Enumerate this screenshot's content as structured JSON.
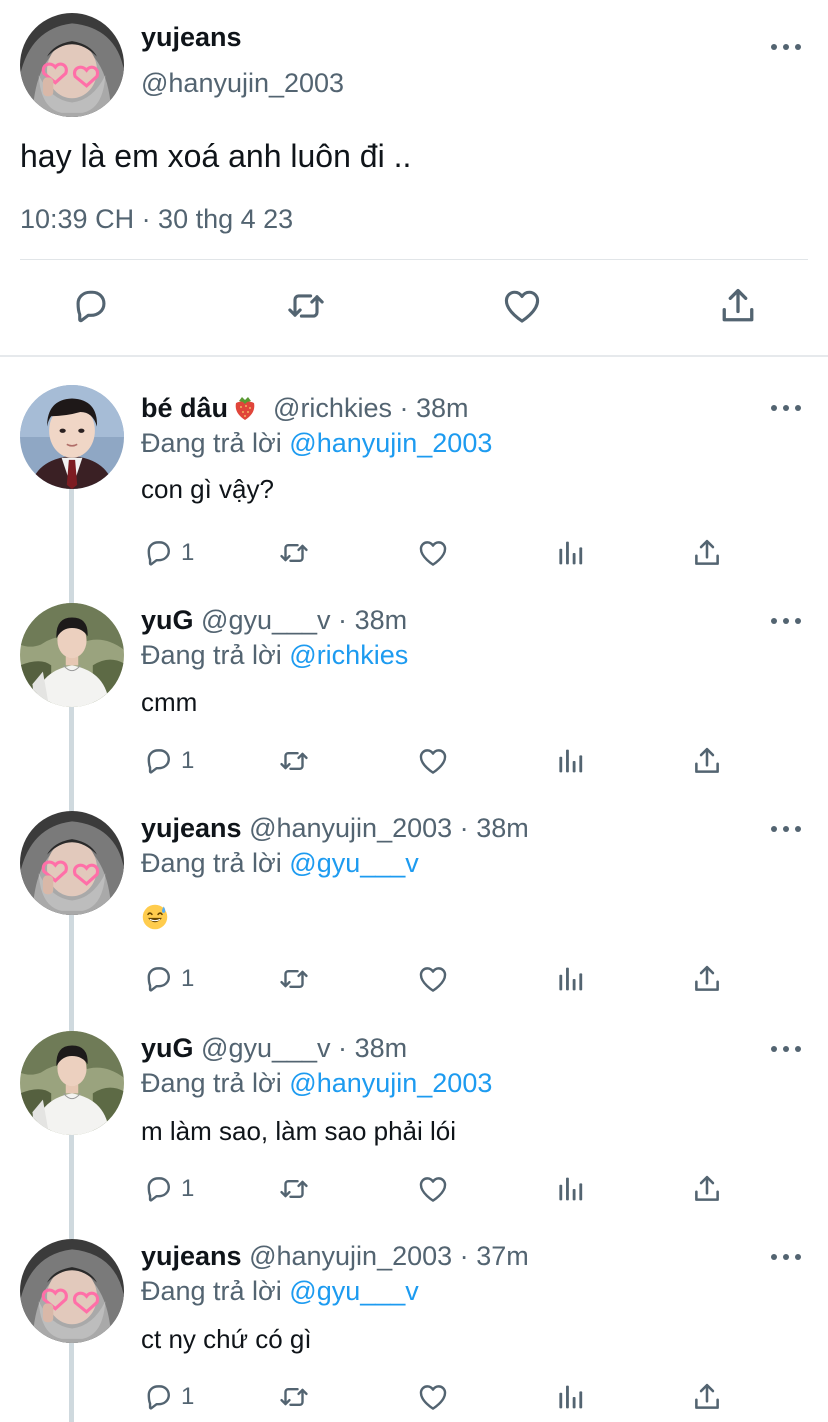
{
  "main_tweet": {
    "name": "yujeans",
    "handle": "@hanyujin_2003",
    "text": "hay là em xoá anh luôn đi ..",
    "timestamp": "10:39 CH · 30 thg 4 23",
    "actions": [
      "reply-icon",
      "retweet-icon",
      "like-icon",
      "share-icon"
    ]
  },
  "replies": [
    {
      "name": "bé dâu",
      "name_emoji": "strawberry",
      "handle": "@richkies",
      "separator": "·",
      "time": "38m",
      "replying_prefix": "Đang trả lời",
      "replying_to": "@hanyujin_2003",
      "text": "con gì vậy?",
      "reply_count": "1",
      "avatar": "boy-uniform"
    },
    {
      "name": "yuG",
      "handle": "@gyu___v",
      "separator": "·",
      "time": "38m",
      "replying_prefix": "Đang trả lời",
      "replying_to": "@richkies",
      "text": "cmm",
      "reply_count": "1",
      "avatar": "boy-white-shirt"
    },
    {
      "name": "yujeans",
      "handle": "@hanyujin_2003",
      "separator": "·",
      "time": "38m",
      "replying_prefix": "Đang trả lời",
      "replying_to": "@gyu___v",
      "text": "",
      "text_emoji": "grinning-sweat",
      "reply_count": "1",
      "avatar": "hoodie-hearts"
    },
    {
      "name": "yuG",
      "handle": "@gyu___v",
      "separator": "·",
      "time": "38m",
      "replying_prefix": "Đang trả lời",
      "replying_to": "@hanyujin_2003",
      "text": "m làm sao, làm sao phải lói",
      "reply_count": "1",
      "avatar": "boy-white-shirt"
    },
    {
      "name": "yujeans",
      "handle": "@hanyujin_2003",
      "separator": "·",
      "time": "37m",
      "replying_prefix": "Đang trả lời",
      "replying_to": "@gyu___v",
      "text": "ct ny chứ có gì",
      "reply_count": "1",
      "avatar": "hoodie-hearts"
    }
  ],
  "colors": {
    "text": "#0f1419",
    "secondary": "#536471",
    "link": "#1d9bf0",
    "thread_line": "#cfd9de"
  }
}
